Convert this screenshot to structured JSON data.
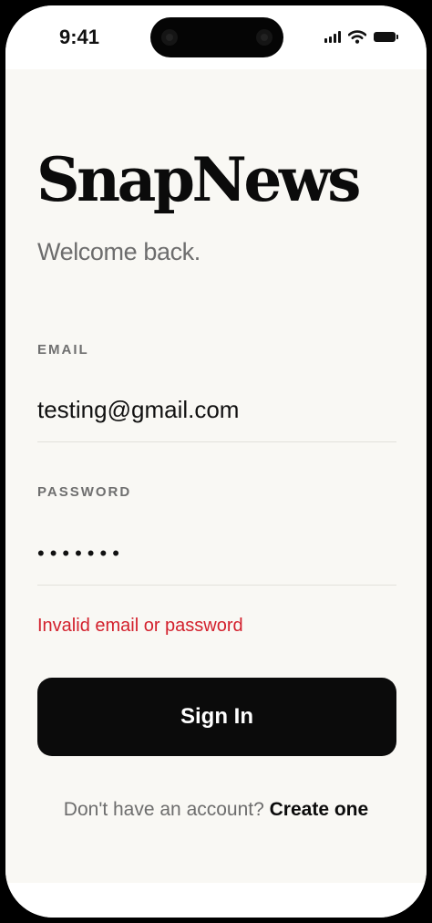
{
  "status_bar": {
    "time": "9:41"
  },
  "app": {
    "name": "SnapNews",
    "subtitle": "Welcome back."
  },
  "form": {
    "email": {
      "label": "EMAIL",
      "value": "testing@gmail.com"
    },
    "password": {
      "label": "PASSWORD",
      "value": "•••••••"
    },
    "error": "Invalid email or password",
    "submit_label": "Sign In"
  },
  "footer": {
    "prompt": "Don't have an account?",
    "link": "Create one"
  },
  "colors": {
    "background": "#f9f8f4",
    "primary": "#0b0b0b",
    "error": "#d3212d",
    "muted": "#6d6d6d"
  },
  "icons": [
    "cellular-signal-icon",
    "wifi-icon",
    "battery-icon"
  ]
}
